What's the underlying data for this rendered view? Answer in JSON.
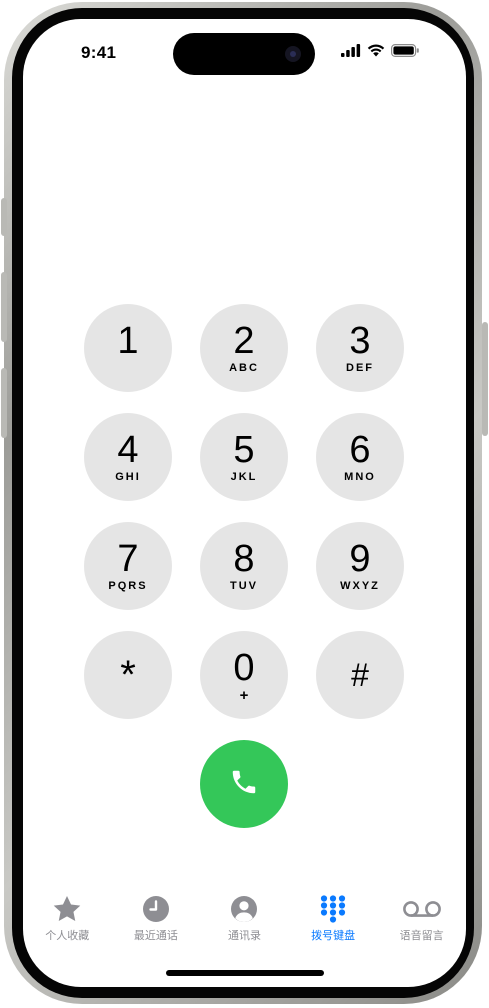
{
  "status_bar": {
    "time": "9:41",
    "icons": [
      "cellular-signal-icon",
      "wifi-icon",
      "battery-icon"
    ]
  },
  "keypad": {
    "keys": [
      {
        "digit": "1",
        "letters": ""
      },
      {
        "digit": "2",
        "letters": "ABC"
      },
      {
        "digit": "3",
        "letters": "DEF"
      },
      {
        "digit": "4",
        "letters": "GHI"
      },
      {
        "digit": "5",
        "letters": "JKL"
      },
      {
        "digit": "6",
        "letters": "MNO"
      },
      {
        "digit": "7",
        "letters": "PQRS"
      },
      {
        "digit": "8",
        "letters": "TUV"
      },
      {
        "digit": "9",
        "letters": "WXYZ"
      },
      {
        "digit": "*",
        "letters": ""
      },
      {
        "digit": "0",
        "letters": "+"
      },
      {
        "digit": "#",
        "letters": ""
      }
    ],
    "call_button_icon": "phone-handset-icon"
  },
  "tab_bar": {
    "active_tab": "keypad",
    "tabs": [
      {
        "id": "favorites",
        "label": "个人收藏",
        "icon": "star-icon"
      },
      {
        "id": "recents",
        "label": "最近通话",
        "icon": "clock-icon"
      },
      {
        "id": "contacts",
        "label": "通讯录",
        "icon": "person-circle-icon"
      },
      {
        "id": "keypad",
        "label": "拨号键盘",
        "icon": "keypad-grid-icon"
      },
      {
        "id": "voicemail",
        "label": "语音留言",
        "icon": "voicemail-icon"
      }
    ]
  },
  "colors": {
    "key_background": "#e5e5e5",
    "call_green": "#34c759",
    "active_tab_blue": "#0a7aff",
    "inactive_tab_gray": "#8e8e93"
  }
}
